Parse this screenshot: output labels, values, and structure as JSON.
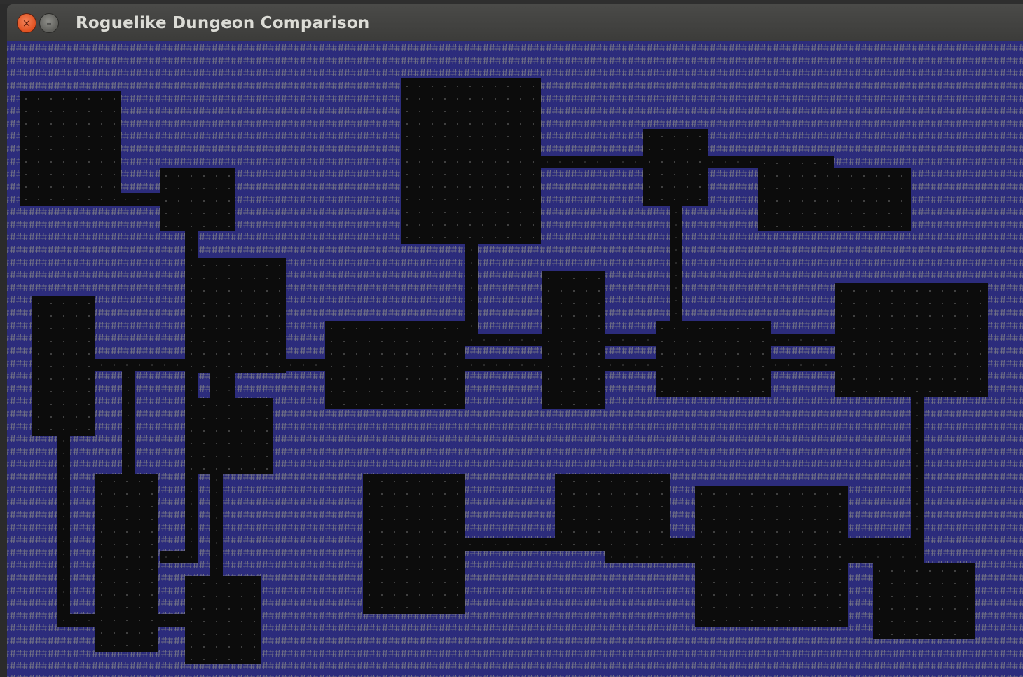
{
  "window": {
    "title": "Roguelike Dungeon Comparison",
    "close_glyph": "×",
    "minimize_glyph": "–",
    "buttons": [
      "close-icon",
      "minimize-icon"
    ]
  },
  "map": {
    "wall_color": "#2c2c7c",
    "floor_color": "#0c0c0c",
    "wall_glyph": "#",
    "floor_glyph": "·"
  }
}
